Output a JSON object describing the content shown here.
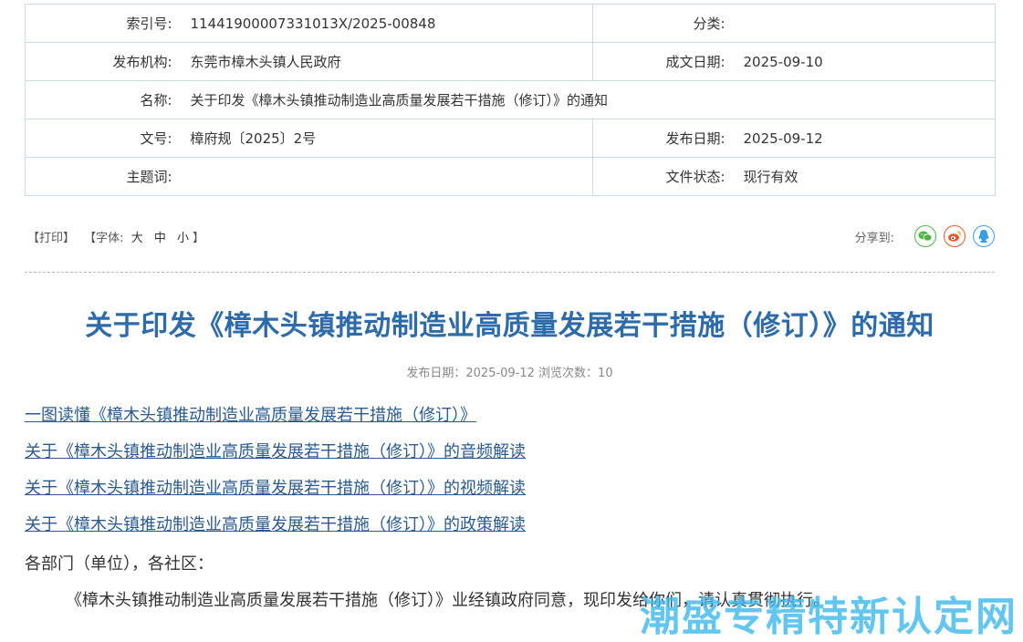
{
  "meta": {
    "index_no_label": "索引号:",
    "index_no_value": "11441900007331013X/2025-00848",
    "category_label": "分类:",
    "category_value": "",
    "publisher_label": "发布机构:",
    "publisher_value": "东莞市樟木头镇人民政府",
    "written_date_label": "成文日期:",
    "written_date_value": "2025-09-10",
    "name_label": "名称:",
    "name_value": "关于印发《樟木头镇推动制造业高质量发展若干措施（修订）》的通知",
    "doc_no_label": "文号:",
    "doc_no_value": "樟府规〔2025〕2号",
    "publish_date_label": "发布日期:",
    "publish_date_value": "2025-09-12",
    "subject_label": "主题词:",
    "subject_value": "",
    "status_label": "文件状态:",
    "status_value": "现行有效"
  },
  "toolbar": {
    "print": "【打印】",
    "font_prefix": "【字体:",
    "font_large": "大",
    "font_medium": "中",
    "font_small": "小",
    "font_suffix": "】",
    "share_label": "分享到:",
    "icons": [
      "wechat-icon",
      "weibo-icon",
      "qq-icon"
    ],
    "icon_colors": {
      "wechat": "#4fb346",
      "weibo": "#e6572f",
      "qq": "#3a9de0"
    }
  },
  "article": {
    "title": "关于印发《樟木头镇推动制造业高质量发展若干措施（修订）》的通知",
    "publish_info": "发布日期：2025-09-12 浏览次数：10",
    "links": [
      "一图读懂《樟木头镇推动制造业高质量发展若干措施（修订）》",
      "关于《樟木头镇推动制造业高质量发展若干措施（修订）》的音频解读",
      "关于《樟木头镇推动制造业高质量发展若干措施（修订）》的视频解读",
      "关于《樟木头镇推动制造业高质量发展若干措施（修订）》的政策解读"
    ],
    "greeting": "各部门（单位），各社区：",
    "paragraph": "《樟木头镇推动制造业高质量发展若干措施（修订）》业经镇政府同意，现印发给你们，请认真贯彻执行。"
  },
  "watermark": "潮盛专精特新认定网",
  "colors": {
    "title": "#2d6bab",
    "link": "#2a5a8f",
    "border": "#c9d9e6"
  }
}
